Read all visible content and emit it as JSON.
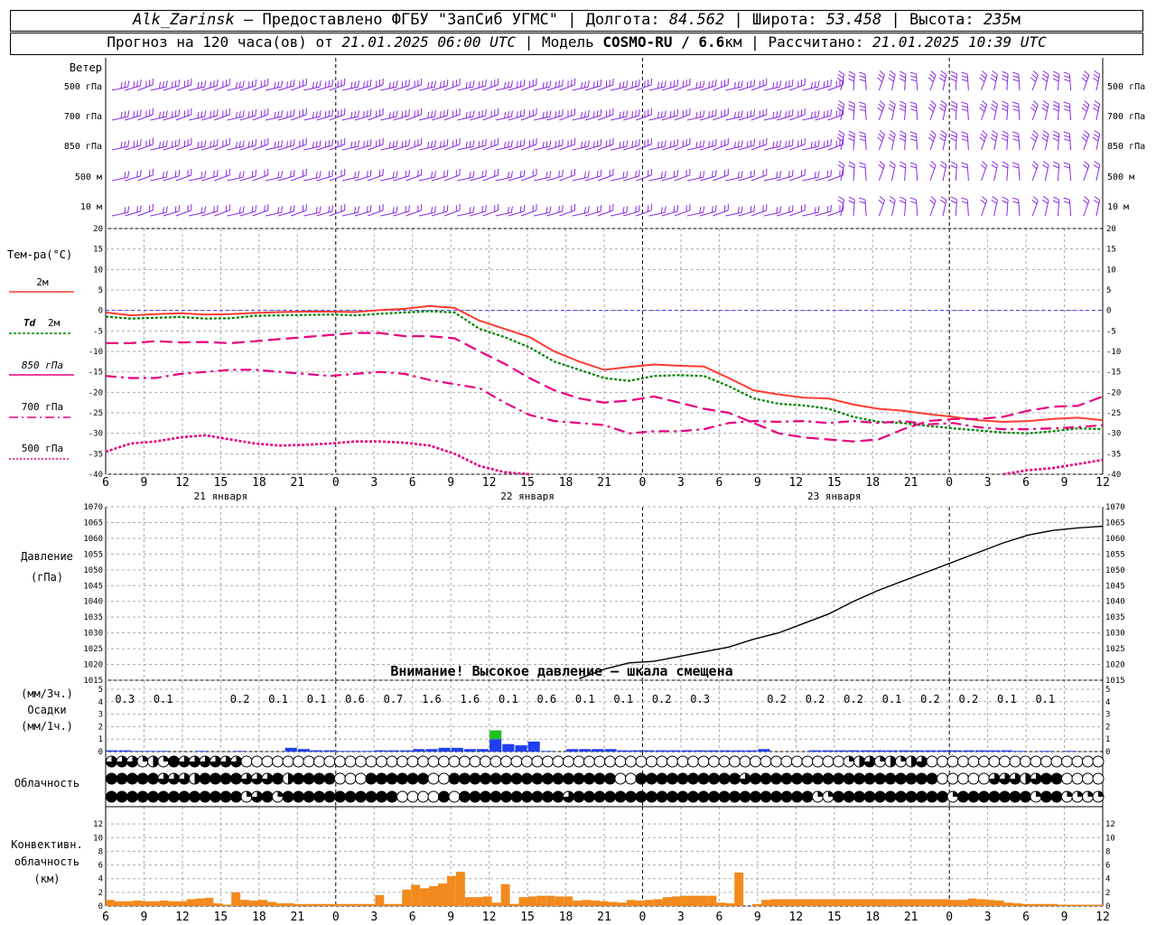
{
  "header": {
    "station": "Alk_Zarinsk",
    "dash": " – ",
    "provider": "Предоставлено ФГБУ \"ЗапСиб УГМС\"",
    "sep": " | ",
    "lon_label": "Долгота: ",
    "lon": "84.562",
    "lat_label": "Широта: ",
    "lat": "53.458",
    "alt_label": "Высота: ",
    "alt": "235",
    "alt_unit": "м",
    "forecast_prefix": "Прогноз на 120 часа(ов) от ",
    "forecast_time": "21.01.2025 06:00 UTC",
    "model_label": "Модель ",
    "model": "COSMO-RU / 6.6",
    "model_unit": "км",
    "computed_label": "Рассчитано: ",
    "computed_time": "21.01.2025 10:39 UTC"
  },
  "colors": {
    "wind": "#8a2be2",
    "t2m": "#ff3b30",
    "td2m": "#008000",
    "t850": "#e6007e",
    "t700": "#e6007e",
    "t500": "#e6007e",
    "pressure": "#000000",
    "precip_blue": "#1f3ff0",
    "precip_green": "#21c021",
    "convective": "#f28a1e",
    "zero_line": "#3a3aff"
  },
  "chart_data": [
    {
      "type": "barbs",
      "title": "Ветер",
      "levels": [
        "500 гПа",
        "700 гПа",
        "850 гПа",
        "500 м",
        "10  м"
      ]
    },
    {
      "type": "line",
      "title": "Тем-ра(°C)",
      "ylim": [
        -40,
        20
      ],
      "yticks": [
        20,
        15,
        10,
        5,
        0,
        -5,
        -10,
        -15,
        -20,
        -25,
        -30,
        -35,
        -40
      ],
      "x_start_hour": 6,
      "x": [
        0,
        3,
        6,
        9,
        12,
        15,
        18,
        21,
        24,
        27,
        30,
        33,
        36,
        39,
        42,
        45,
        48,
        51,
        54,
        57,
        60,
        63,
        66,
        69,
        72,
        75,
        78,
        81,
        84,
        87,
        90,
        93,
        96,
        99,
        102,
        105,
        108,
        111,
        114,
        117,
        120,
        123,
        126,
        129,
        132,
        135,
        138,
        141,
        144,
        147,
        150,
        153,
        156,
        159,
        162,
        165,
        168,
        171,
        174,
        177,
        180,
        183,
        186,
        189,
        192,
        195,
        198,
        201,
        204,
        207,
        210,
        213,
        216,
        219,
        222,
        225,
        228,
        231,
        234,
        237,
        240,
        243,
        246,
        249,
        252,
        255,
        258,
        261,
        264,
        267,
        270,
        273,
        276,
        279,
        282,
        285,
        288,
        291,
        294,
        297,
        300,
        303,
        306,
        309,
        312,
        315,
        318,
        321,
        324,
        327,
        330,
        333,
        336,
        339,
        342,
        345,
        348,
        351,
        354,
        357,
        360
      ],
      "xtick_labels": [
        "6",
        "9",
        "12",
        "15",
        "18",
        "21",
        "0",
        "3",
        "6",
        "9",
        "12",
        "15",
        "18",
        "21",
        "0",
        "3",
        "6",
        "9",
        "12",
        "15",
        "18",
        "21",
        "0",
        "3",
        "6",
        "9",
        "12"
      ],
      "day_labels": [
        "21 января",
        "22 января",
        "23 января"
      ],
      "series": [
        {
          "name": "2м",
          "style": "solid",
          "x": [
            0,
            3,
            6,
            9,
            12,
            15,
            18,
            21,
            24,
            27,
            30,
            33,
            36,
            39,
            42,
            45,
            48,
            51,
            54,
            57,
            60,
            63,
            66,
            69,
            72
          ],
          "values": [
            -0.5,
            -1.0,
            -0.8,
            -0.6,
            -1.0,
            -0.9,
            -0.5,
            -0.3,
            -0.2,
            -0.2,
            -0.3,
            0.2,
            0.5,
            1.0,
            0.5,
            -2.0,
            -4.0,
            -6.0,
            -9.0,
            -11.5,
            -13.5,
            -14.5,
            -14.0,
            -13.5,
            -13.5
          ]
        },
        {
          "name": "Td 2м",
          "style": "dotted",
          "values": []
        },
        {
          "name": "850 гПа",
          "style": "dashed",
          "values": []
        },
        {
          "name": "700 гПа",
          "style": "dashdot",
          "values": []
        },
        {
          "name": "500 гПа",
          "style": "dotted",
          "values": []
        }
      ],
      "t2m": [
        -0.5,
        -1.2,
        -0.9,
        -0.7,
        -1.0,
        -0.9,
        -0.6,
        -0.4,
        -0.3,
        -0.3,
        -0.4,
        0.1,
        0.4,
        1.1,
        0.6,
        -2.5,
        -4.5,
        -6.5,
        -10.0,
        -12.5,
        -14.5,
        -13.8,
        -13.2,
        -13.5,
        -13.7,
        -16.5,
        -19.5,
        -20.5,
        -21.3,
        -21.5,
        -23.0,
        -24.0,
        -24.5,
        -25.3,
        -26.0,
        -26.8,
        -27.2,
        -27.0,
        -26.5,
        -26.2,
        -26.8
      ],
      "td2m": [
        -1.5,
        -2.0,
        -1.8,
        -1.6,
        -2.0,
        -1.9,
        -1.3,
        -1.2,
        -1.1,
        -1.0,
        -1.2,
        -0.8,
        -0.5,
        -0.2,
        -0.5,
        -4.5,
        -6.5,
        -9.0,
        -12.5,
        -14.5,
        -16.5,
        -17.2,
        -16.0,
        -15.8,
        -16.0,
        -18.5,
        -21.5,
        -22.8,
        -23.2,
        -24.0,
        -26.0,
        -27.2,
        -27.5,
        -28.2,
        -28.8,
        -29.3,
        -29.8,
        -30.0,
        -29.5,
        -28.8,
        -29.0
      ],
      "t850": [
        -8.0,
        -8.0,
        -7.5,
        -7.8,
        -7.7,
        -8.0,
        -7.5,
        -7.0,
        -6.5,
        -6.0,
        -5.5,
        -5.5,
        -6.3,
        -6.3,
        -6.8,
        -10.0,
        -13.0,
        -16.5,
        -19.5,
        -21.5,
        -22.5,
        -22.0,
        -21.0,
        -22.5,
        -24.0,
        -25.0,
        -27.5,
        -30.0,
        -31.0,
        -31.5,
        -32.0,
        -31.5,
        -29.0,
        -27.0,
        -26.5,
        -26.5,
        -26.0,
        -24.5,
        -23.5,
        -23.3,
        -21.0
      ],
      "t700": [
        -16.0,
        -16.5,
        -16.5,
        -15.5,
        -15.0,
        -14.5,
        -14.5,
        -15.0,
        -15.5,
        -16.0,
        -15.5,
        -15.0,
        -15.5,
        -17.0,
        -18.0,
        -19.0,
        -22.5,
        -25.5,
        -27.0,
        -27.5,
        -28.0,
        -30.0,
        -29.5,
        -29.5,
        -29.0,
        -27.5,
        -27.0,
        -27.2,
        -27.0,
        -27.5,
        -27.0,
        -27.5,
        -27.0,
        -27.8,
        -27.5,
        -28.5,
        -29.0,
        -29.0,
        -28.8,
        -28.5,
        -28.0
      ],
      "t500": [
        -34.5,
        -32.5,
        -32.0,
        -31.0,
        -30.5,
        -31.5,
        -32.5,
        -33.0,
        -32.8,
        -32.5,
        -32.0,
        -32.0,
        -32.3,
        -33.0,
        -35.0,
        -38.0,
        -39.5,
        -40.5,
        null,
        null,
        null,
        null,
        null,
        null,
        null,
        null,
        null,
        null,
        null,
        null,
        null,
        null,
        null,
        null,
        null,
        null,
        -40.0,
        -39.0,
        -38.5,
        -37.5,
        -36.5
      ],
      "t_hours": [
        0,
        3,
        6,
        9,
        12,
        15,
        18,
        21,
        24,
        27,
        30,
        33,
        36,
        39,
        42,
        45,
        48,
        51,
        54,
        57,
        60,
        63,
        66,
        69,
        72,
        75,
        78,
        81,
        84,
        87,
        90,
        93,
        96,
        99,
        102,
        105,
        108,
        111,
        114,
        117,
        120
      ]
    },
    {
      "type": "line",
      "title": "Давление",
      "ylabel": "(гПа)",
      "ylim": [
        1015,
        1070
      ],
      "yticks": [
        1070,
        1065,
        1060,
        1055,
        1050,
        1045,
        1040,
        1035,
        1030,
        1025,
        1020,
        1015
      ],
      "hours": [
        0,
        3,
        6,
        9,
        12,
        15,
        18,
        21,
        24,
        27,
        30,
        33,
        36,
        39,
        42,
        45,
        48,
        51,
        54,
        57,
        60,
        63,
        66,
        69,
        72,
        75,
        78,
        81,
        84,
        87,
        90,
        93,
        96,
        99,
        102,
        105,
        108,
        111,
        114,
        117,
        120
      ],
      "values": [
        null,
        null,
        null,
        null,
        null,
        null,
        null,
        null,
        null,
        null,
        null,
        null,
        null,
        null,
        null,
        null,
        null,
        null,
        null,
        1015.5,
        1018.5,
        1020.5,
        1021.0,
        1022.5,
        1024.0,
        1025.5,
        1028.0,
        1030.0,
        1033.0,
        1036.0,
        1040.0,
        1043.5,
        1046.5,
        1049.5,
        1052.5,
        1055.5,
        1058.5,
        1061.0,
        1062.5,
        1063.3,
        1063.8
      ],
      "warning": "Внимание! Высокое давление – шкала смещена"
    },
    {
      "type": "bar",
      "title": "Осадки",
      "ylabel_top": "(мм/3ч.)",
      "ylabel_bottom": "(мм/1ч.)",
      "ylim": [
        0,
        5
      ],
      "yticks": [
        5,
        4,
        3,
        2,
        1,
        0
      ],
      "totals_3h": [
        "0.3",
        "0.1",
        "",
        "0.2",
        "0.1",
        "0.1",
        "0.6",
        "0.7",
        "1.6",
        "1.6",
        "0.1",
        "0.6",
        "0.1",
        "0.1",
        "0.2",
        "0.3",
        "",
        "0.2",
        "0.2",
        "0.2",
        "0.1",
        "0.2",
        "0.2",
        "0.1",
        "0.1",
        "",
        ""
      ],
      "hourly_blue": [
        0.1,
        0.1,
        0.05,
        0.05,
        0.05,
        0,
        0,
        0.05,
        0,
        0,
        0.05,
        0,
        0,
        0,
        0.3,
        0.2,
        0.1,
        0.1,
        0.05,
        0.05,
        0.05,
        0.1,
        0.1,
        0.1,
        0.2,
        0.2,
        0.3,
        0.3,
        0.2,
        0.2,
        1.0,
        0.6,
        0.5,
        0.8,
        0.05,
        0,
        0.2,
        0.2,
        0.2,
        0.2,
        0.1,
        0.1,
        0.1,
        0.1,
        0.1,
        0.1,
        0.1,
        0.1,
        0.1,
        0.1,
        0.1,
        0.2,
        0,
        0,
        0,
        0.1,
        0.1,
        0.1,
        0.1,
        0.1,
        0.1,
        0.1,
        0.1,
        0.1,
        0.1,
        0.1,
        0.1,
        0.1,
        0.1,
        0.1,
        0.1,
        0.05,
        0,
        0.05,
        0,
        0.05,
        0,
        0
      ],
      "hourly_green": [
        0,
        0,
        0,
        0,
        0,
        0,
        0,
        0,
        0,
        0,
        0,
        0,
        0,
        0,
        0,
        0,
        0,
        0,
        0,
        0,
        0,
        0,
        0,
        0,
        0,
        0,
        0,
        0,
        0,
        0,
        0.7,
        0,
        0,
        0,
        0,
        0,
        0,
        0,
        0,
        0,
        0,
        0,
        0,
        0,
        0,
        0,
        0,
        0,
        0,
        0,
        0,
        0,
        0,
        0,
        0,
        0,
        0,
        0,
        0,
        0,
        0,
        0,
        0,
        0,
        0,
        0,
        0,
        0,
        0,
        0,
        0,
        0,
        0,
        0,
        0,
        0,
        0,
        0
      ]
    },
    {
      "type": "symbols",
      "title": "Облачность",
      "rows": [
        "333121433333300000000000000000000000000000000000000000000000000000000001231212300000000000000000",
        "444443332444433342444400044444400444444444444444400444444444434444444444444444440000033323440000",
        "444444444444413414444444444400004044444444443444444444444444444444441144444444444144444441441111"
      ]
    },
    {
      "type": "bar",
      "title": "Конвективн.",
      "subtitle": "облачность",
      "ylabel": "(км)",
      "ylim": [
        0,
        14
      ],
      "yticks": [
        12,
        10,
        8,
        6,
        4,
        2,
        0
      ],
      "values": [
        0.9,
        0.7,
        0.7,
        0.8,
        0.7,
        0.7,
        0.8,
        0.7,
        0.7,
        1.0,
        1.1,
        1.2,
        0.4,
        0.2,
        2.0,
        0.9,
        0.8,
        0.9,
        0.6,
        0.4,
        0.4,
        0.3,
        0.3,
        0.3,
        0.3,
        0.3,
        0.3,
        0.3,
        0.3,
        0.3,
        1.6,
        0.3,
        0.3,
        2.4,
        3.1,
        2.6,
        2.9,
        3.3,
        4.4,
        5.0,
        1.3,
        1.3,
        1.4,
        0.5,
        3.2,
        0.3,
        1.3,
        1.4,
        1.5,
        1.5,
        1.4,
        1.4,
        0.8,
        0.9,
        0.8,
        0.7,
        0.6,
        0.5,
        0.9,
        0.8,
        0.9,
        1.0,
        1.3,
        1.4,
        1.5,
        1.5,
        1.5,
        1.5,
        0.5,
        0.4,
        4.9,
        0,
        0.3,
        0.9,
        1.0,
        1.0,
        1.0,
        1.0,
        1.0,
        1.0,
        1.0,
        1.0,
        1.0,
        1.0,
        1.0,
        1.0,
        1.0,
        1.0,
        1.0,
        1.0,
        1.0,
        1.0,
        1.0,
        1.0,
        0.9,
        0.9,
        1.1,
        1.0,
        0.9,
        0.8,
        0.5,
        0.4,
        0.3,
        0.3,
        0.3,
        0.3,
        0.2,
        0.2,
        0.2,
        0.2,
        0.2
      ]
    }
  ],
  "legend": {
    "t2m": "2м",
    "td2m_a": "Td",
    "td2m_b": "2м",
    "t850": "850 гПа",
    "t700": "700 гПа",
    "t500": "500 гПа"
  },
  "labels": {
    "wind": "Ветер",
    "temp": "Тем-ра(°C)",
    "pressure": "Давление",
    "pressure_unit": "(гПа)",
    "precip_unit_3h": "(мм/3ч.)",
    "precip": "Осадки",
    "precip_unit_1h": "(мм/1ч.)",
    "cloud": "Облачность",
    "conv1": "Конвективн.",
    "conv2": "облачность",
    "conv_unit": "(км)"
  }
}
